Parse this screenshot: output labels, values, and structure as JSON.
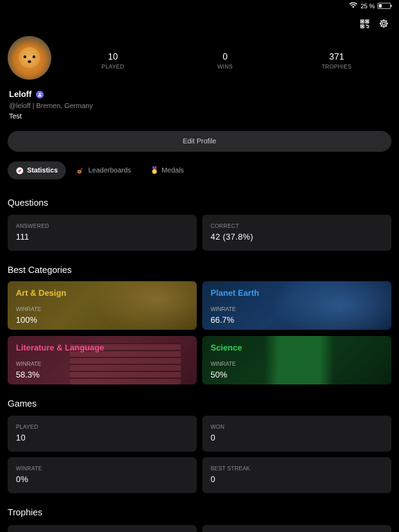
{
  "status_bar": {
    "battery_text": "25 %",
    "battery_level": 0.25
  },
  "profile": {
    "username": "Leloff",
    "meta": "@leloff | Bremen, Germany",
    "bio": "Test",
    "stats": [
      {
        "value": "10",
        "label": "PLAYED"
      },
      {
        "value": "0",
        "label": "WINS"
      },
      {
        "value": "371",
        "label": "TROPHIES"
      }
    ],
    "edit_button": "Edit Profile"
  },
  "tabs": [
    {
      "label": "Statistics",
      "icon": "compass-icon",
      "active": true
    },
    {
      "label": "Leaderboards",
      "icon": "guitar-icon",
      "active": false
    },
    {
      "label": "Medals",
      "icon": "medal-icon",
      "active": false
    }
  ],
  "questions": {
    "title": "Questions",
    "cards": [
      {
        "label": "ANSWERED",
        "value": "111"
      },
      {
        "label": "CORRECT",
        "value": "42 (37.8%)"
      }
    ]
  },
  "best_categories": {
    "title": "Best Categories",
    "items": [
      {
        "name": "Art & Design",
        "label": "WINRATE",
        "value": "100%",
        "color": "#e8c23a"
      },
      {
        "name": "Planet Earth",
        "label": "WINRATE",
        "value": "66.7%",
        "color": "#3a9cf0"
      },
      {
        "name": "Literature & Language",
        "label": "WINRATE",
        "value": "58.3%",
        "color": "#f0508a"
      },
      {
        "name": "Science",
        "label": "WINRATE",
        "value": "50%",
        "color": "#2ed65a"
      }
    ]
  },
  "games": {
    "title": "Games",
    "cards": [
      {
        "label": "PLAYED",
        "value": "10"
      },
      {
        "label": "WON",
        "value": "0"
      },
      {
        "label": "WINRATE",
        "value": "0%"
      },
      {
        "label": "BEST STREAK",
        "value": "0"
      }
    ]
  },
  "trophies": {
    "title": "Trophies"
  }
}
